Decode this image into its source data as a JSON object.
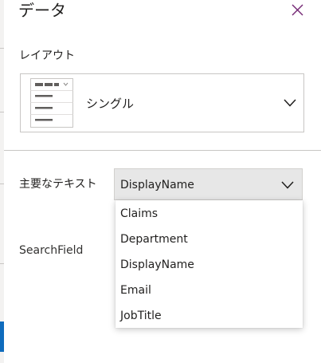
{
  "panel": {
    "title": "データ",
    "close_icon": "close-icon"
  },
  "layout": {
    "label": "レイアウト",
    "value": "シングル",
    "icon": "single-layout-thumbnail-icon"
  },
  "primary_text": {
    "label": "主要なテキスト",
    "value": "DisplayName",
    "options": [
      "Claims",
      "Department",
      "DisplayName",
      "Email",
      "JobTitle"
    ]
  },
  "search_field": {
    "label": "SearchField"
  },
  "colors": {
    "accent": "#742774",
    "dropdown_bg": "#e7e7e7",
    "border": "#c8c6c4"
  }
}
